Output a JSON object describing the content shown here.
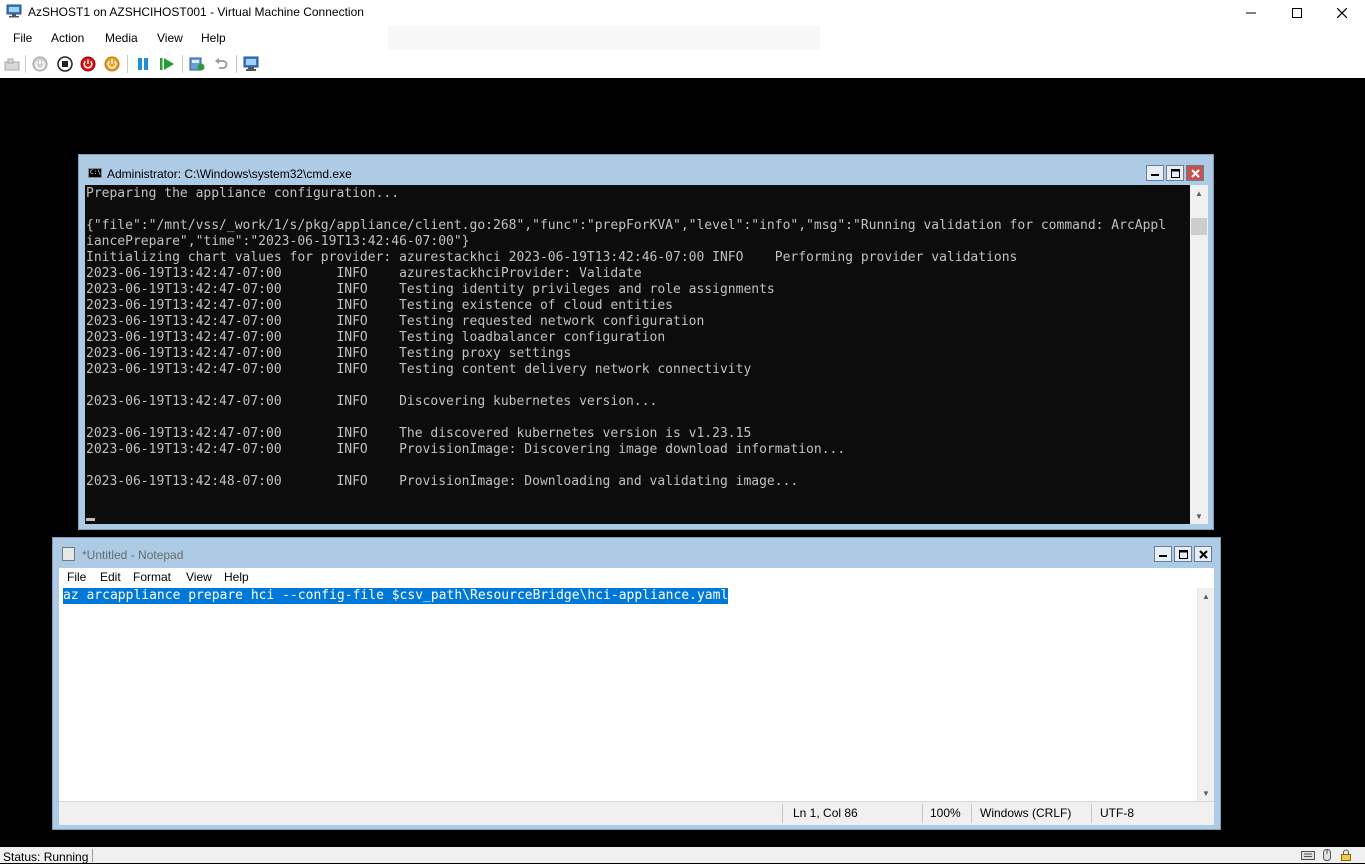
{
  "window": {
    "title": "AzSHOST1 on AZSHCIHOST001 - Virtual Machine Connection"
  },
  "menu": [
    "File",
    "Action",
    "Media",
    "View",
    "Help"
  ],
  "toolbar_icons": [
    "ctrl-alt-del-icon",
    "start-icon",
    "turn-off-icon",
    "shutdown-icon",
    "save-state-icon",
    "pause-icon",
    "resume-icon",
    "checkpoint-icon",
    "revert-icon",
    "enhanced-session-icon"
  ],
  "cmd": {
    "title": "Administrator: C:\\Windows\\system32\\cmd.exe",
    "lines": [
      "Preparing the appliance configuration...",
      "",
      "{\"file\":\"/mnt/vss/_work/1/s/pkg/appliance/client.go:268\",\"func\":\"prepForKVA\",\"level\":\"info\",\"msg\":\"Running validation for command: ArcAppl",
      "iancePrepare\",\"time\":\"2023-06-19T13:42:46-07:00\"}",
      "Initializing chart values for provider: azurestackhci 2023-06-19T13:42:46-07:00 INFO    Performing provider validations",
      "2023-06-19T13:42:47-07:00       INFO    azurestackhciProvider: Validate",
      "2023-06-19T13:42:47-07:00       INFO    Testing identity privileges and role assignments",
      "2023-06-19T13:42:47-07:00       INFO    Testing existence of cloud entities",
      "2023-06-19T13:42:47-07:00       INFO    Testing requested network configuration",
      "2023-06-19T13:42:47-07:00       INFO    Testing loadbalancer configuration",
      "2023-06-19T13:42:47-07:00       INFO    Testing proxy settings",
      "2023-06-19T13:42:47-07:00       INFO    Testing content delivery network connectivity",
      "",
      "2023-06-19T13:42:47-07:00       INFO    Discovering kubernetes version...",
      "",
      "2023-06-19T13:42:47-07:00       INFO    The discovered kubernetes version is v1.23.15",
      "2023-06-19T13:42:47-07:00       INFO    ProvisionImage: Discovering image download information...",
      "",
      "2023-06-19T13:42:48-07:00       INFO    ProvisionImage: Downloading and validating image..."
    ]
  },
  "notepad": {
    "title": "*Untitled - Notepad",
    "menu": [
      "File",
      "Edit",
      "Format",
      "View",
      "Help"
    ],
    "content": "az arcappliance prepare hci --config-file $csv_path\\ResourceBridge\\hci-appliance.yaml",
    "status": {
      "position": "Ln 1, Col 86",
      "zoom": "100%",
      "line_ending": "Windows (CRLF)",
      "encoding": "UTF-8"
    }
  },
  "status_bar": {
    "text": "Status: Running"
  }
}
